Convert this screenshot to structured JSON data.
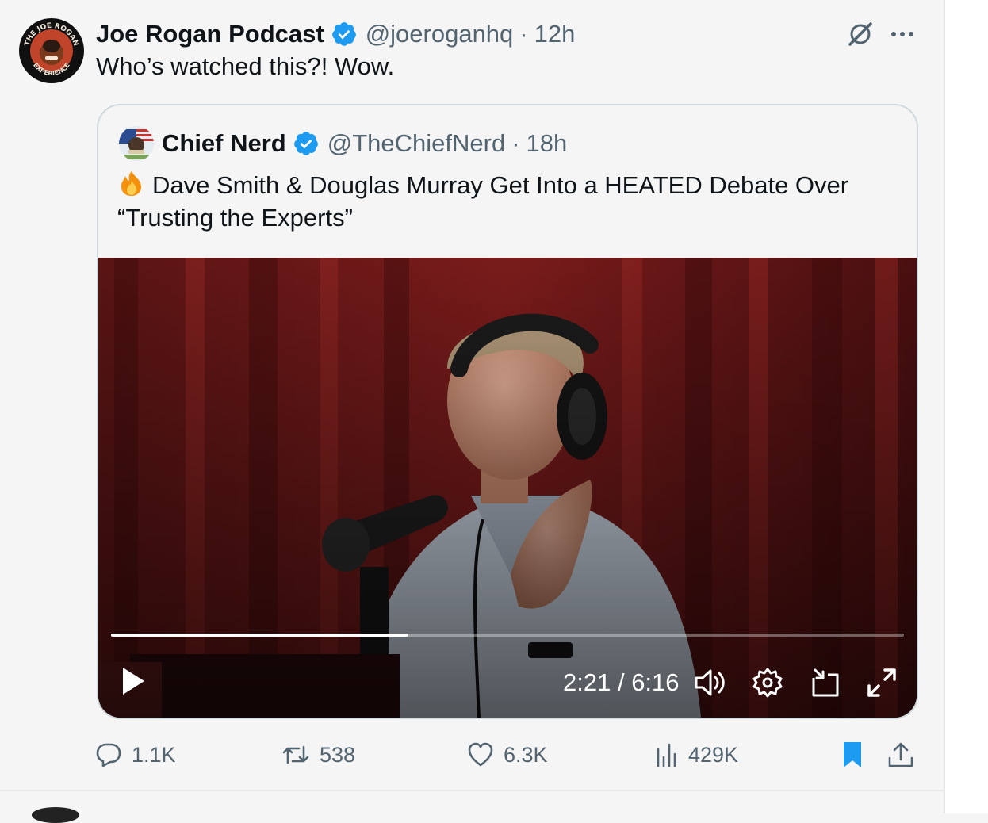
{
  "tweet": {
    "author_name": "Joe Rogan Podcast",
    "author_handle": "@joeroganhq",
    "separator": "·",
    "time": "12h",
    "text": "Who’s watched this?! Wow.",
    "avatar_text": {
      "top": "THE JOE ROGAN",
      "bottom": "EXPERIENCE"
    }
  },
  "quoted": {
    "author_name": "Chief Nerd",
    "author_handle": "@TheChiefNerd",
    "separator": "·",
    "time": "18h",
    "text": "Dave Smith & Douglas Murray Get Into a HEATED Debate Over “Trusting the Experts”",
    "emoji": "fire-icon"
  },
  "video": {
    "current_time": "2:21",
    "duration": "6:16",
    "time_separator": " / ",
    "progress_fraction": 0.375
  },
  "actions": {
    "replies": "1.1K",
    "reposts": "538",
    "likes": "6.3K",
    "views": "429K"
  },
  "colors": {
    "accent": "#1d9bf0",
    "muted": "#536471",
    "text": "#0f1419",
    "border": "#cfd9de"
  }
}
